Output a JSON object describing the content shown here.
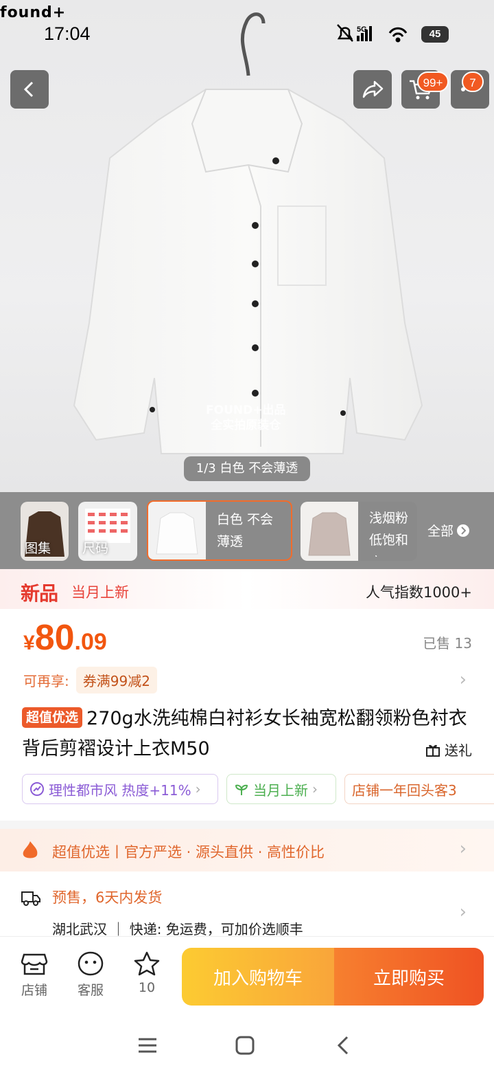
{
  "status_bar": {
    "brand": "found+",
    "time": "17:04",
    "battery": "45"
  },
  "header": {
    "cart_badge": "99+",
    "more_badge": "7"
  },
  "image_counter": "1/3 白色 不会薄透",
  "thumbnails": {
    "gallery_label": "图集",
    "size_label": "尺码",
    "selected_option_label": "白色 不会薄透",
    "option2_label": "浅烟粉 低饱和度",
    "all_label": "全部"
  },
  "new_banner": {
    "logo": "新品",
    "text": "当月上新",
    "popularity": "人气指数1000+"
  },
  "price": {
    "currency": "¥",
    "integer": "80",
    "decimal": ".09",
    "sold": "已售 13"
  },
  "coupon": {
    "label": "可再享:",
    "value": "券满99减2"
  },
  "title": {
    "tag": "超值优选",
    "text": "270g水洗纯棉白衬衫女长袖宽松翻领粉色衬衣背后剪褶设计上衣M50"
  },
  "gift_label": "送礼",
  "chips": [
    {
      "text": "理性都市风 热度+11%"
    },
    {
      "text": "当月上新"
    },
    {
      "text": "店铺一年回头客3"
    }
  ],
  "promo_text": "超值优选丨官方严选 · 源头直供 · 高性价比",
  "shipping": {
    "title": "预售，6天内发货",
    "detail": "湖北武汉 ｜ 快递: 免运费，可加价选顺丰"
  },
  "bottom_bar": {
    "store_label": "店铺",
    "service_label": "客服",
    "favorite_count": "10",
    "add_to_cart": "加入购物车",
    "buy_now": "立即购买"
  },
  "watermark": {
    "line1": "FOUND+出品",
    "line2": "全实拍原装仓"
  },
  "colors": {
    "accent": "#f2560f",
    "cart_button": "#fbb936",
    "buy_button": "#f26a2a"
  }
}
